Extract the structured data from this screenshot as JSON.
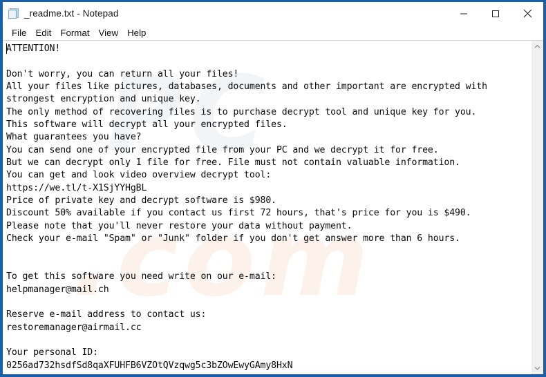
{
  "window": {
    "title": "_readme.txt - Notepad",
    "icon": "notepad-icon",
    "border_color": "#1a5fa8",
    "controls": {
      "minimize_label": "Minimize",
      "maximize_label": "Maximize",
      "close_label": "Close"
    }
  },
  "menu": {
    "items": [
      {
        "label": "File"
      },
      {
        "label": "Edit"
      },
      {
        "label": "Format"
      },
      {
        "label": "View"
      },
      {
        "label": "Help"
      }
    ]
  },
  "document": {
    "filename": "_readme.txt",
    "caret_visible": true,
    "lines": [
      "ATTENTION!",
      "",
      "Don't worry, you can return all your files!",
      "All your files like pictures, databases, documents and other important are encrypted with",
      "strongest encryption and unique key.",
      "The only method of recovering files is to purchase decrypt tool and unique key for you.",
      "This software will decrypt all your encrypted files.",
      "What guarantees you have?",
      "You can send one of your encrypted file from your PC and we decrypt it for free.",
      "But we can decrypt only 1 file for free. File must not contain valuable information.",
      "You can get and look video overview decrypt tool:",
      "https://we.tl/t-X1SjYYHgBL",
      "Price of private key and decrypt software is $980.",
      "Discount 50% available if you contact us first 72 hours, that's price for you is $490.",
      "Please note that you'll never restore your data without payment.",
      "Check your e-mail \"Spam\" or \"Junk\" folder if you don't get answer more than 6 hours.",
      "",
      "",
      "To get this software you need write on our e-mail:",
      "helpmanager@mail.ch",
      "",
      "Reserve e-mail address to contact us:",
      "restoremanager@airmail.cc",
      "",
      "Your personal ID:",
      "0256ad732hsdfSd8qaXFUHFB6VZOtQVzqwg5c3bZOwEwyGAmy8HxN"
    ],
    "key_values": {
      "video_overview_url": "https://we.tl/t-X1SjYYHgBL",
      "price": "$980",
      "discount_price": "$490",
      "discount_percent": "50%",
      "discount_hours": "72 hours",
      "answer_wait_hours": "6 hours",
      "primary_email": "helpmanager@mail.ch",
      "reserve_email": "restoremanager@airmail.cc",
      "personal_id": "0256ad732hsdfSd8qaXFUHFB6VZOtQVzqwg5c3bZOwEwyGAmy8HxN"
    }
  },
  "scrollbar": {
    "up_arrow": "chevron-up-icon",
    "down_arrow": "chevron-down-icon"
  }
}
